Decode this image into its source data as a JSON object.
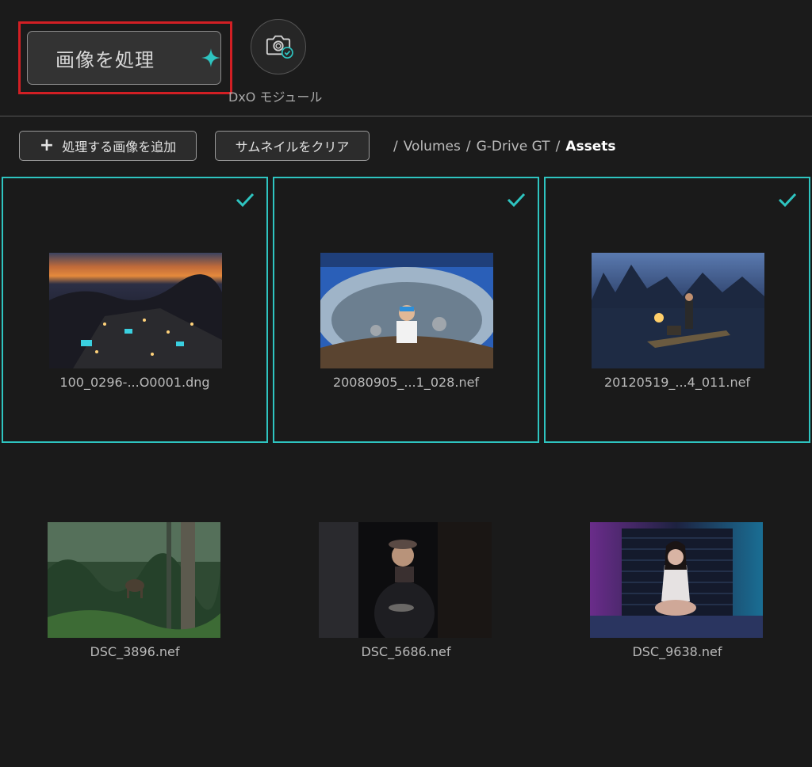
{
  "header": {
    "process_button_label": "画像を処理",
    "dxo_module_label": "DxO モジュール"
  },
  "toolbar": {
    "add_images_label": "処理する画像を追加",
    "clear_thumbnails_label": "サムネイルをクリア",
    "breadcrumb": [
      "Volumes",
      "G-Drive GT",
      "Assets"
    ]
  },
  "grid": {
    "items": [
      {
        "filename": "100_0296-...O0001.dng",
        "selected": true
      },
      {
        "filename": "20080905_...1_028.nef",
        "selected": true
      },
      {
        "filename": "20120519_...4_011.nef",
        "selected": true
      },
      {
        "filename": "DSC_3896.nef",
        "selected": false
      },
      {
        "filename": "DSC_5686.nef",
        "selected": false
      },
      {
        "filename": "DSC_9638.nef",
        "selected": false
      }
    ]
  },
  "colors": {
    "accent": "#2ec4c0",
    "highlight": "#d21f24",
    "background": "#1b1b1b"
  },
  "icons": {
    "process": "sparkle-icon",
    "dxo_module": "camera-check-icon",
    "add": "plus-icon",
    "selected": "checkmark-icon"
  }
}
